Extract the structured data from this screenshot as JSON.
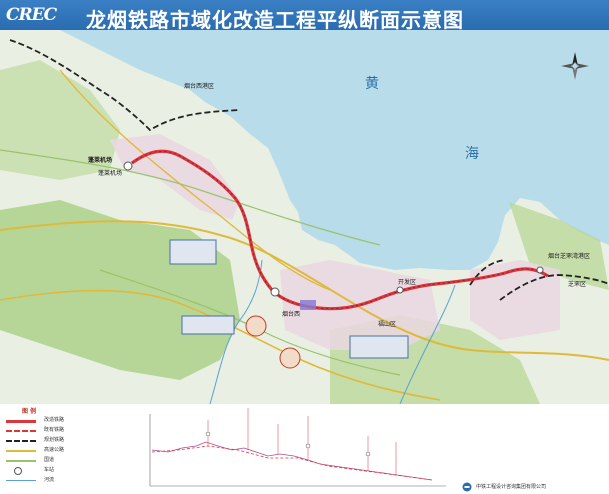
{
  "header": {
    "logo": "CREC",
    "title": "龙烟铁路市域化改造工程平纵断面示意图"
  },
  "map": {
    "sea_labels": [
      "黄",
      "海"
    ],
    "places": [
      "蓬莱机场",
      "烟台西港区",
      "开发区",
      "福山区",
      "芝罘区",
      "烟台芝罘湾港区"
    ],
    "stations": [
      "蓬莱机场",
      "烟台西"
    ]
  },
  "legend": {
    "title": "图 例",
    "items": [
      {
        "label": "改造铁路",
        "color": "#d9363e"
      },
      {
        "label": "既有铁路",
        "color": "#d9363e"
      },
      {
        "label": "规划铁路",
        "color": "#222222"
      },
      {
        "label": "高速公路",
        "color": "#e0b93a"
      },
      {
        "label": "国道",
        "color": "#9bc26b"
      },
      {
        "label": "车站",
        "color": "#555555"
      },
      {
        "label": "河流",
        "color": "#5aa0d6"
      }
    ]
  },
  "footer": {
    "company": "中铁工程设计咨询集团有限公司"
  },
  "colors": {
    "sea": "#b8dcea",
    "land": "#e9efe2",
    "green": "#a9cf86",
    "urban": "#ead7e2",
    "rail": "#d9363e",
    "header": "#2b6cb0"
  }
}
